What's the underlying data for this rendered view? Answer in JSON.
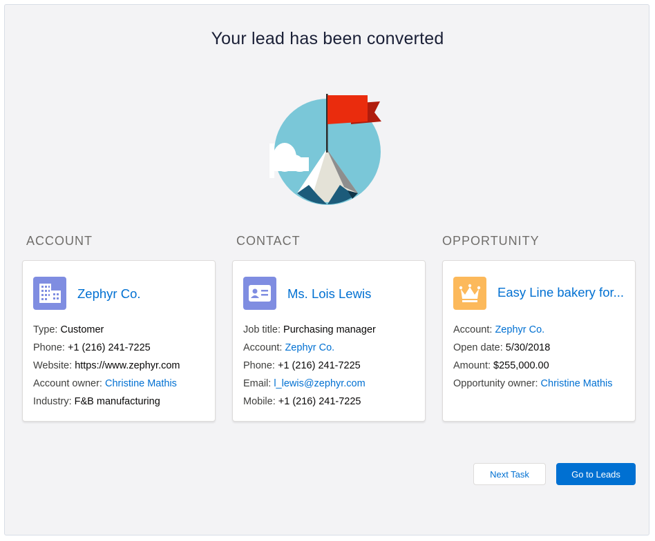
{
  "page": {
    "title": "Your lead has been converted"
  },
  "colors": {
    "account_icon_bg": "#7f8de1",
    "contact_icon_bg": "#7f8de1",
    "opportunity_icon_bg": "#fcb95b",
    "link": "#0070d2",
    "brand_button": "#0070d2"
  },
  "account": {
    "section_label": "ACCOUNT",
    "icon": "building-icon",
    "name": "Zephyr Co.",
    "fields": [
      {
        "label": "Type: ",
        "value": "Customer"
      },
      {
        "label": "Phone: ",
        "value": "+1 (216) 241-7225"
      },
      {
        "label": "Website: ",
        "value": "https://www.zephyr.com"
      },
      {
        "label": "Account owner: ",
        "value": "Christine Mathis"
      },
      {
        "label": "Industry: ",
        "value": "F&B manufacturing"
      }
    ]
  },
  "contact": {
    "section_label": "CONTACT",
    "icon": "contact-card-icon",
    "name": "Ms. Lois Lewis",
    "fields": [
      {
        "label": "Job title: ",
        "value": "Purchasing manager"
      },
      {
        "label": "Account: ",
        "value": "Zephyr Co."
      },
      {
        "label": "Phone: ",
        "value": "+1 (216) 241-7225"
      },
      {
        "label": "Email: ",
        "value": "l_lewis@zephyr.com"
      },
      {
        "label": "Mobile: ",
        "value": "+1 (216) 241-7225"
      }
    ]
  },
  "opportunity": {
    "section_label": "OPPORTUNITY",
    "icon": "crown-icon",
    "name": "Easy Line bakery for...",
    "fields": [
      {
        "label": "Account: ",
        "value": "Zephyr Co."
      },
      {
        "label": "Open date: ",
        "value": "5/30/2018"
      },
      {
        "label": "Amount: ",
        "value": "$255,000.00"
      },
      {
        "label": "Opportunity owner: ",
        "value": "Christine Mathis"
      }
    ]
  },
  "actions": {
    "next_task_label": "Next Task",
    "go_to_leads_label": "Go to Leads"
  }
}
